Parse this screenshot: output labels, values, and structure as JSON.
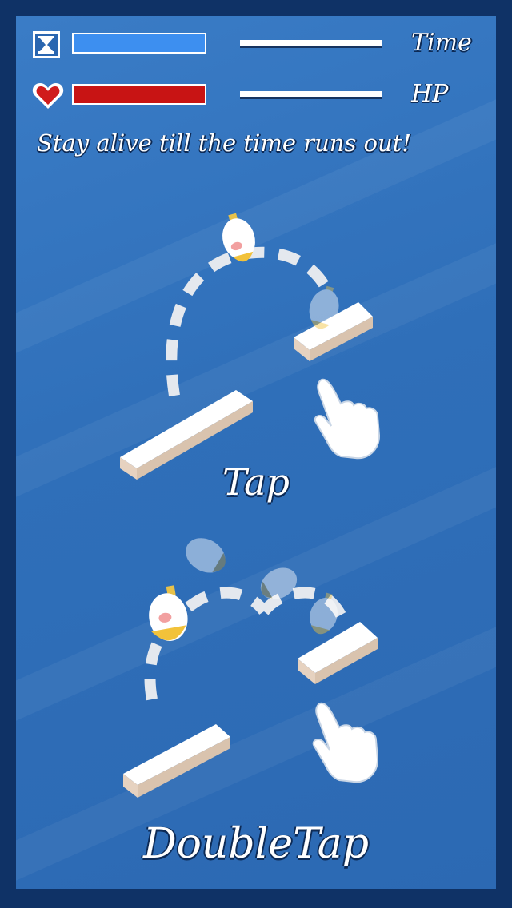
{
  "hud": {
    "time": {
      "label": "Time",
      "fill": 1.0,
      "color": "#3d8ff0"
    },
    "hp": {
      "label": "HP",
      "fill": 1.0,
      "color": "#c81414"
    }
  },
  "instruction": "Stay alive till the time runs out!",
  "gestures": [
    {
      "label": "Tap"
    },
    {
      "label": "DoubleTap"
    }
  ],
  "colors": {
    "background": "#2f6fb9",
    "frame": "#0f3266",
    "platform_top": "#ffffff",
    "platform_side": "#e6d2c0"
  },
  "icons": [
    "hourglass-icon",
    "heart-icon",
    "hand-pointer-icon",
    "character-icon"
  ]
}
